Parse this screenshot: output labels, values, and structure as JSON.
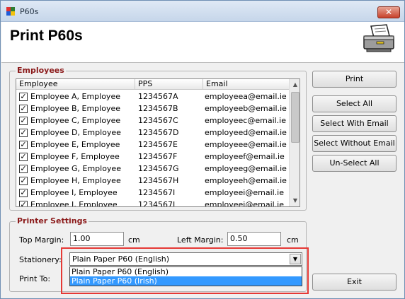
{
  "window": {
    "title": "P60s",
    "close_glyph": "✕"
  },
  "header": {
    "page_title": "Print P60s",
    "icon": "printer-icon"
  },
  "employees_group": {
    "label": "Employees"
  },
  "grid": {
    "columns": [
      "Employee",
      "PPS",
      "Email"
    ],
    "rows": [
      {
        "checked": true,
        "name": "Employee A, Employee",
        "pps": "1234567A",
        "email": "employeea@email.ie"
      },
      {
        "checked": true,
        "name": "Employee B, Employee",
        "pps": "1234567B",
        "email": "employeeb@email.ie"
      },
      {
        "checked": true,
        "name": "Employee C, Employee",
        "pps": "1234567C",
        "email": "employeec@email.ie"
      },
      {
        "checked": true,
        "name": "Employee D, Employee",
        "pps": "1234567D",
        "email": "employeed@email.ie"
      },
      {
        "checked": true,
        "name": "Employee E, Employee",
        "pps": "1234567E",
        "email": "employeee@email.ie"
      },
      {
        "checked": true,
        "name": "Employee F, Employee",
        "pps": "1234567F",
        "email": "employeef@email.ie"
      },
      {
        "checked": true,
        "name": "Employee G, Employee",
        "pps": "1234567G",
        "email": "employeeg@email.ie"
      },
      {
        "checked": true,
        "name": "Employee H, Employee",
        "pps": "1234567H",
        "email": "employeeh@email.ie"
      },
      {
        "checked": true,
        "name": "Employee I, Employee",
        "pps": "1234567I",
        "email": "employeei@email.ie"
      },
      {
        "checked": true,
        "name": "Employee J, Employee",
        "pps": "1234567J",
        "email": "employeej@email.ie"
      }
    ]
  },
  "buttons": {
    "print": "Print",
    "select_all": "Select All",
    "select_with_email": "Select With Email",
    "select_without_email": "Select Without Email",
    "unselect_all": "Un-Select All",
    "exit": "Exit"
  },
  "printer_settings": {
    "label": "Printer Settings",
    "top_margin_label": "Top Margin:",
    "top_margin_value": "1.00",
    "top_margin_unit": "cm",
    "left_margin_label": "Left Margin:",
    "left_margin_value": "0.50",
    "left_margin_unit": "cm",
    "stationery_label": "Stationery:",
    "stationery_selected": "Plain Paper P60 (English)",
    "stationery_options": [
      "Plain Paper P60 (English)",
      "Plain Paper P60 (Irish)"
    ],
    "highlighted_option_index": 1,
    "print_to_label": "Print To:"
  },
  "colors": {
    "group_label": "#8b1a1a",
    "selection": "#3399ff",
    "highlight_box": "#e53935"
  }
}
